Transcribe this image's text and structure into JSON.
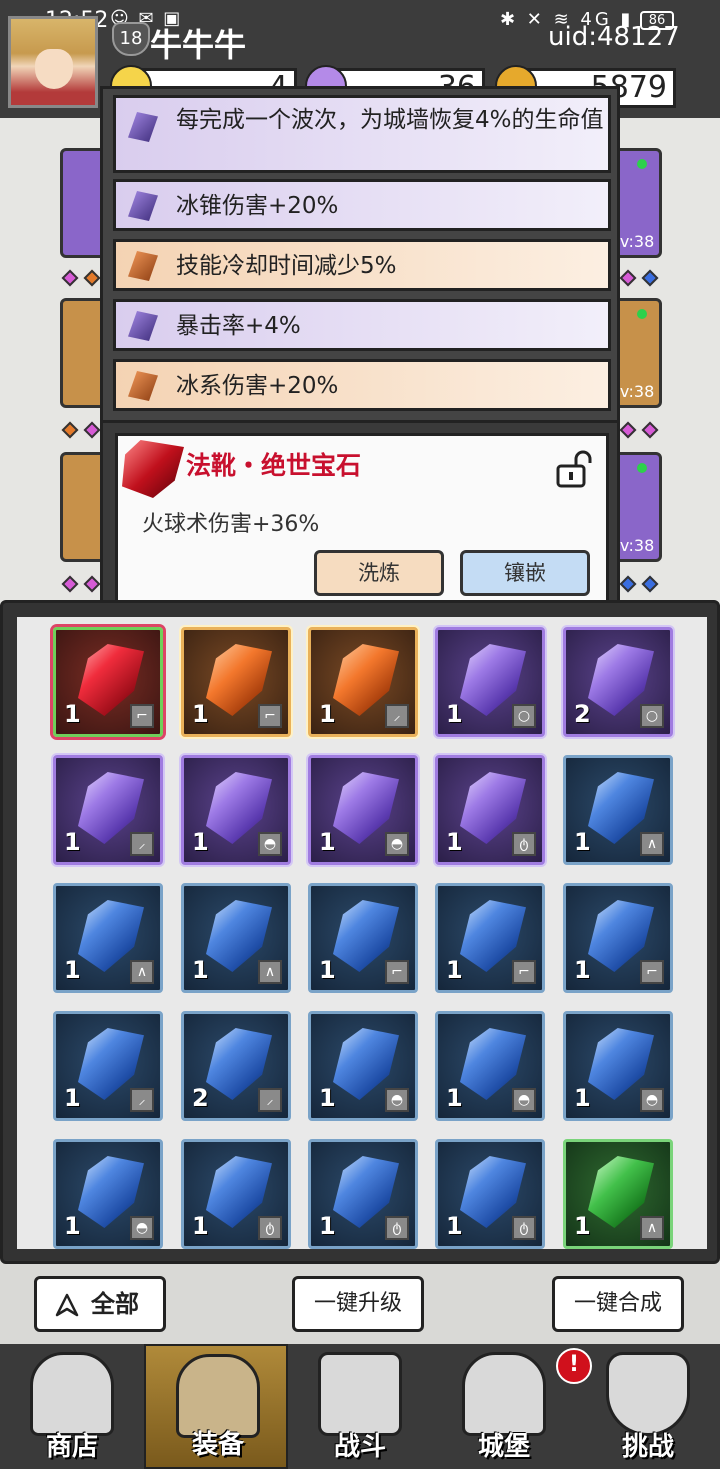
{
  "status_bar": {
    "time": "12:52",
    "notification_icons": "☺ ✉ ▣",
    "system_icons": "✱ ✕ ≋ 4G ▮",
    "battery": "86"
  },
  "player": {
    "level": "18",
    "name": "牛牛牛",
    "uid": "uid:48127"
  },
  "resources": {
    "gold_value": "4",
    "gem_value": "36",
    "coin_value": "5879"
  },
  "equipment": {
    "levels": [
      "Lv:38",
      "Lv:38",
      "Lv:38"
    ]
  },
  "affixes": [
    {
      "text": "每完成一个波次，为城墙恢复4%的生命值",
      "rarity": "purple"
    },
    {
      "text": "冰锥伤害+20%",
      "rarity": "purple"
    },
    {
      "text": "技能冷却时间减少5%",
      "rarity": "orange"
    },
    {
      "text": "暴击率+4%",
      "rarity": "purple"
    },
    {
      "text": "冰系伤害+20%",
      "rarity": "orange"
    }
  ],
  "gem_popup": {
    "title": "法靴・绝世宝石",
    "description": "火球术伤害+36%",
    "refine_label": "洗炼",
    "inlay_label": "镶嵌",
    "lock_state": "unlocked",
    "title_color": "#c8102e"
  },
  "inventory": [
    {
      "rarity": "red",
      "count": "1",
      "slot": "boots"
    },
    {
      "rarity": "orange",
      "count": "1",
      "slot": "boots"
    },
    {
      "rarity": "orange",
      "count": "1",
      "slot": "staff"
    },
    {
      "rarity": "purple",
      "count": "1",
      "slot": "ring"
    },
    {
      "rarity": "purple",
      "count": "2",
      "slot": "ring"
    },
    {
      "rarity": "purple",
      "count": "1",
      "slot": "staff"
    },
    {
      "rarity": "purple",
      "count": "1",
      "slot": "hat"
    },
    {
      "rarity": "purple",
      "count": "1",
      "slot": "hat"
    },
    {
      "rarity": "purple",
      "count": "1",
      "slot": "necklace"
    },
    {
      "rarity": "blue",
      "count": "1",
      "slot": "robe"
    },
    {
      "rarity": "blue",
      "count": "1",
      "slot": "robe"
    },
    {
      "rarity": "blue",
      "count": "1",
      "slot": "robe"
    },
    {
      "rarity": "blue",
      "count": "1",
      "slot": "boots"
    },
    {
      "rarity": "blue",
      "count": "1",
      "slot": "boots"
    },
    {
      "rarity": "blue",
      "count": "1",
      "slot": "boots"
    },
    {
      "rarity": "blue",
      "count": "1",
      "slot": "staff"
    },
    {
      "rarity": "blue",
      "count": "2",
      "slot": "staff"
    },
    {
      "rarity": "blue",
      "count": "1",
      "slot": "hat"
    },
    {
      "rarity": "blue",
      "count": "1",
      "slot": "hat"
    },
    {
      "rarity": "blue",
      "count": "1",
      "slot": "hat"
    },
    {
      "rarity": "blue",
      "count": "1",
      "slot": "hat"
    },
    {
      "rarity": "blue",
      "count": "1",
      "slot": "necklace"
    },
    {
      "rarity": "blue",
      "count": "1",
      "slot": "necklace"
    },
    {
      "rarity": "blue",
      "count": "1",
      "slot": "necklace"
    },
    {
      "rarity": "green",
      "count": "1",
      "slot": "robe"
    }
  ],
  "actions": {
    "filter_label": "全部",
    "upgrade_all_label": "一键升级",
    "merge_all_label": "一键合成"
  },
  "nav": [
    {
      "label": "商店",
      "icon": "shop-hut-icon",
      "active": false
    },
    {
      "label": "装备",
      "icon": "backpack-icon",
      "active": true
    },
    {
      "label": "战斗",
      "icon": "crossed-swords-icon",
      "active": false
    },
    {
      "label": "城堡",
      "icon": "castle-icon",
      "active": false,
      "alert": "!"
    },
    {
      "label": "挑战",
      "icon": "shield-icon",
      "active": false
    }
  ]
}
